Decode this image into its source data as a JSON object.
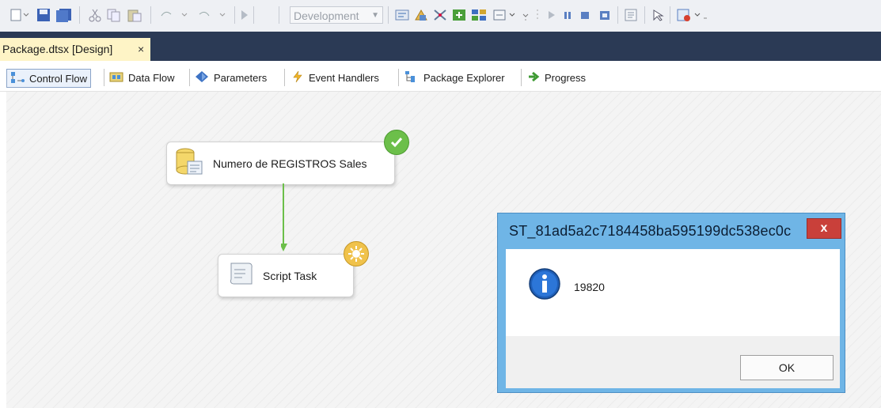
{
  "toolbar": {
    "configuration": "Development"
  },
  "document_tab": {
    "title": "Package.dtsx [Design]",
    "close": "×"
  },
  "designer_tabs": [
    {
      "label": "Control Flow",
      "icon": "control-flow-icon"
    },
    {
      "label": "Data Flow",
      "icon": "data-flow-icon"
    },
    {
      "label": "Parameters",
      "icon": "parameters-icon"
    },
    {
      "label": "Event Handlers",
      "icon": "event-handlers-icon"
    },
    {
      "label": "Package Explorer",
      "icon": "package-explorer-icon"
    },
    {
      "label": "Progress",
      "icon": "progress-icon"
    }
  ],
  "tasks": [
    {
      "label": "Numero de REGISTROS Sales",
      "icon": "execute-sql-task-icon",
      "status": "success"
    },
    {
      "label": "Script Task",
      "icon": "script-task-icon",
      "status": "running"
    }
  ],
  "colors": {
    "tab_bar": "#2b3a55",
    "active_doc_tab": "#fef4c6",
    "success": "#6cbf4a",
    "running": "#f0c24b",
    "dialog_frame": "#6fb5e6",
    "dialog_close": "#c9403a"
  },
  "dialog": {
    "title": "ST_81ad5a2c7184458ba595199dc538ec0c",
    "close": "x",
    "icon": "information-icon",
    "message": "19820",
    "ok_label": "OK"
  }
}
